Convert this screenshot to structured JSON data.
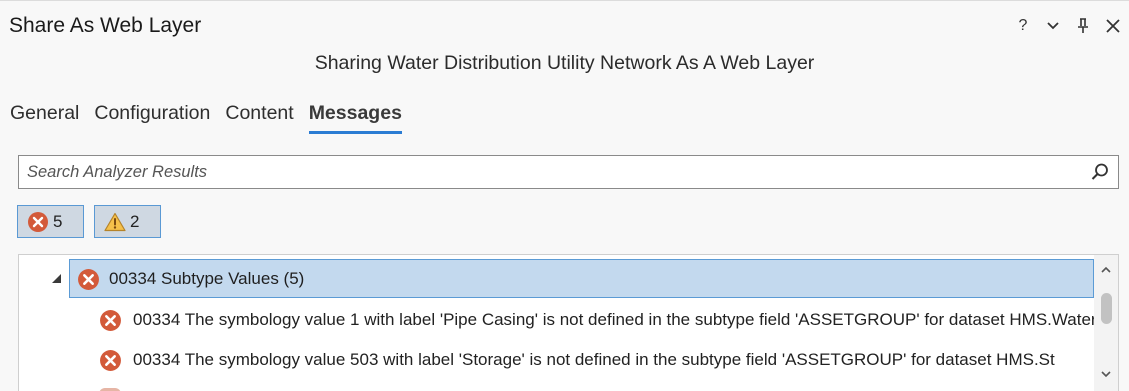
{
  "window": {
    "title": "Share As Web Layer",
    "controls": {
      "help": "?",
      "menu": "⌄",
      "pin": "⊥",
      "close": "✕"
    }
  },
  "subtitle": "Sharing Water Distribution Utility Network As A Web Layer",
  "tabs": [
    {
      "label": "General",
      "active": false
    },
    {
      "label": "Configuration",
      "active": false
    },
    {
      "label": "Content",
      "active": false
    },
    {
      "label": "Messages",
      "active": true
    }
  ],
  "search": {
    "placeholder": "Search Analyzer Results",
    "value": ""
  },
  "filters": {
    "errors_count": "5",
    "warnings_count": "2"
  },
  "results": {
    "group": {
      "label": "00334 Subtype Values (5)",
      "expanded": true,
      "selected": true
    },
    "items": [
      {
        "text": "00334 The symbology value 1 with label 'Pipe Casing' is not defined in the subtype field 'ASSETGROUP' for dataset HMS.Water"
      },
      {
        "text": "00334 The symbology value 503 with label 'Storage' is not defined in the subtype field 'ASSETGROUP' for dataset HMS.St"
      }
    ]
  },
  "colors": {
    "error": "#d35a3a",
    "warning_fill": "#f5c04a",
    "tab_underline": "#2b7cd3",
    "selection": "#c3d9ee"
  },
  "icons": {
    "search": "search-icon",
    "error": "error-icon",
    "warning": "warning-icon"
  }
}
